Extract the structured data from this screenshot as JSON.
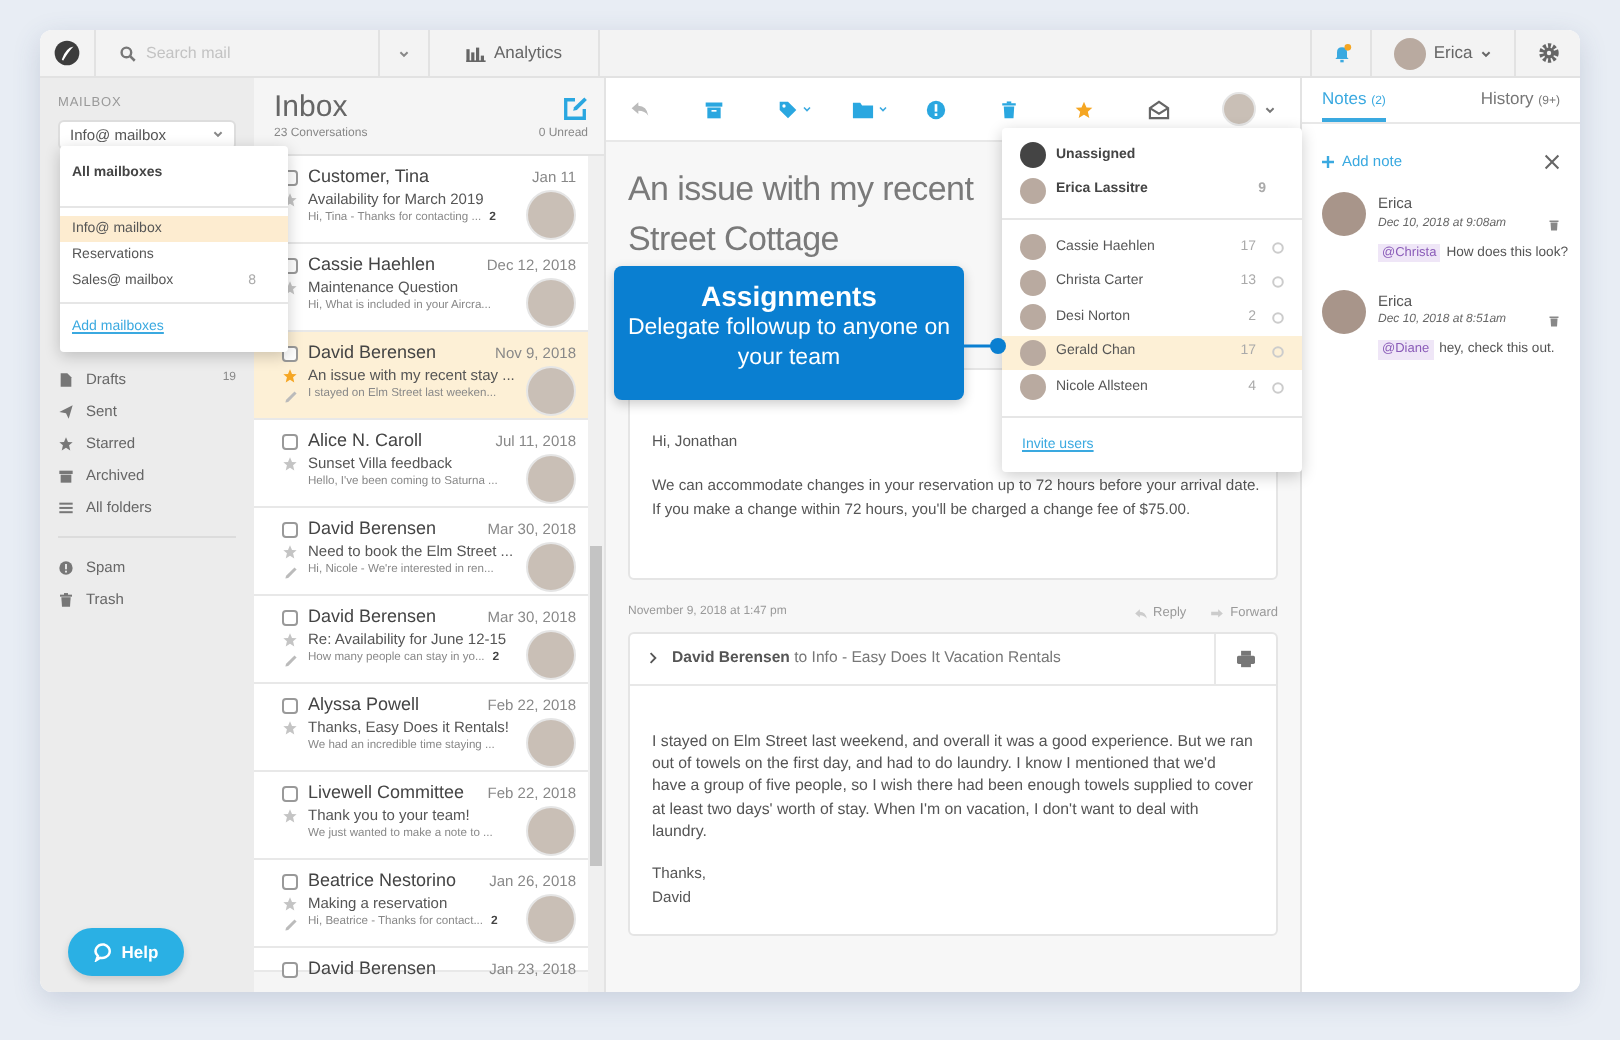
{
  "top_bar": {
    "search": {
      "placeholder": "Search mail"
    },
    "analytics": "Analytics",
    "user": "Erica"
  },
  "sidebar": {
    "label": "MAILBOX",
    "mailbox_select": "Info@ mailbox",
    "mailbox_menu": {
      "items": [
        {
          "label": "All mailboxes",
          "kind": "all",
          "selected": false
        },
        {
          "label": "Info@ mailbox",
          "kind": "mailbox",
          "selected": true
        },
        {
          "label": "Reservations",
          "kind": "mailbox",
          "selected": false
        },
        {
          "label": "Sales@ mailbox",
          "kind": "mailbox",
          "count": "8",
          "selected": false
        }
      ],
      "action": "Add mailboxes"
    },
    "folder_groups": [
      [
        {
          "label": "Drafts",
          "kind": "drafts",
          "count": "19"
        },
        {
          "label": "Sent",
          "kind": "sent"
        },
        {
          "label": "Starred",
          "kind": "starred"
        },
        {
          "label": "Archived",
          "kind": "archived"
        },
        {
          "label": "All folders",
          "kind": "all"
        }
      ],
      [
        {
          "label": "Spam",
          "kind": "spam"
        },
        {
          "label": "Trash",
          "kind": "trash"
        }
      ]
    ],
    "help": "Help"
  },
  "inbox": {
    "title": "Inbox",
    "conversations": "23 Conversations",
    "unread": "0 Unread",
    "rows": [
      {
        "sender": "Customer, Tina",
        "date": "Jan 11",
        "subject": "Availability for March 2019",
        "preview": "Hi, Tina - Thanks for contacting ...",
        "count": "2",
        "checked": false,
        "starred": false,
        "selected": false
      },
      {
        "sender": "Cassie Haehlen",
        "date": "Dec 12, 2018",
        "subject": "Maintenance Question",
        "preview": "Hi, What is included in your Aircra...",
        "checked": false,
        "starred": false,
        "selected": false
      },
      {
        "sender": "David Berensen",
        "date": "Nov 9, 2018",
        "subject": "An issue with my recent stay ...",
        "preview": "I stayed on Elm Street last weeken...",
        "checked": false,
        "starred": true,
        "draft": true,
        "selected": true
      },
      {
        "sender": "Alice N. Caroll",
        "date": "Jul 11, 2018",
        "subject": "Sunset Villa feedback",
        "preview": "Hello, I've been coming to Saturna ...",
        "checked": false,
        "starred": false,
        "selected": false
      },
      {
        "sender": "David Berensen",
        "date": "Mar 30, 2018",
        "subject": "Need to book the Elm Street ...",
        "preview": "Hi, Nicole - We're interested in ren...",
        "checked": false,
        "starred": false,
        "draft": true,
        "selected": false
      },
      {
        "sender": "David Berensen",
        "date": "Mar 30, 2018",
        "subject": "Re: Availability for June 12-15",
        "preview": "How many people can stay in yo...",
        "count": "2",
        "checked": false,
        "starred": false,
        "draft": true,
        "selected": false
      },
      {
        "sender": "Alyssa Powell",
        "date": "Feb 22, 2018",
        "subject": "Thanks, Easy Does it Rentals!",
        "preview": "We had an incredible time staying ...",
        "checked": false,
        "starred": false,
        "selected": false
      },
      {
        "sender": "Livewell Committee",
        "date": "Feb 22, 2018",
        "subject": "Thank you to your team!",
        "preview": "We just wanted to make a note to ...",
        "checked": false,
        "starred": false,
        "selected": false
      },
      {
        "sender": "Beatrice Nestorino",
        "date": "Jan 26, 2018",
        "subject": "Making a reservation",
        "preview": "Hi, Beatrice - Thanks for contact...",
        "count": "2",
        "checked": false,
        "starred": false,
        "draft": true,
        "selected": false
      },
      {
        "sender": "David Berensen",
        "date": "Jan 23, 2018",
        "checked": false,
        "selected": false
      }
    ]
  },
  "conversation": {
    "subject_lines": [
      "An issue with my recent",
      "Street Cottage"
    ],
    "assign_menu": {
      "top": [
        {
          "name": "Unassigned",
          "kind": "unassigned",
          "selected": false
        },
        {
          "name": "Erica Lassitre",
          "kind": "user",
          "count": "9",
          "selected": false
        }
      ],
      "team": [
        {
          "name": "Cassie Haehlen",
          "count": "17",
          "selected": false
        },
        {
          "name": "Christa Carter",
          "count": "13",
          "selected": false
        },
        {
          "name": "Desi Norton",
          "count": "2",
          "selected": false
        },
        {
          "name": "Gerald Chan",
          "count": "17",
          "selected": true
        },
        {
          "name": "Nicole Allsteen",
          "count": "4",
          "selected": false
        }
      ],
      "action": "Invite users"
    },
    "callout": {
      "title": "Assignments",
      "text": "Delegate followup to anyone on your team"
    },
    "reply": {
      "greeting": "Hi, Jonathan",
      "lines": [
        "We can accommodate changes in your reservation up to 72 hours before your arrival date.",
        "If you make a change within 72 hours, you'll be charged a change fee of $75.00."
      ]
    },
    "message": {
      "timestamp": "November 9, 2018 at 1:47 pm",
      "reply": "Reply",
      "forward": "Forward",
      "header": "**David Berensen** to Info - Easy Does It Vacation Rentals",
      "body": "I stayed on Elm Street last weekend, and overall it was a good experience. But we ran out of towels on the first day, and had to do laundry. I know I mentioned that we'd have a group of five people, so I wish there had been enough towels supplied to cover at least two days' worth of stay. When I'm on vacation, I don't want to deal with laundry.",
      "closing": [
        "Thanks,",
        "David"
      ]
    }
  },
  "notes": {
    "tabs": [
      {
        "label": "Notes",
        "count": "(2)",
        "selected": true
      },
      {
        "label": "History",
        "count": "(9+)",
        "selected": false
      }
    ],
    "add": "Add note",
    "items": [
      {
        "author": "Erica",
        "time": "Dec 10, 2018 at 9:08am",
        "mention": "@Christa",
        "text": "How does this look?"
      },
      {
        "author": "Erica",
        "time": "Dec 10, 2018 at 8:51am",
        "mention": "@Diane",
        "text": "hey, check this out."
      }
    ]
  }
}
